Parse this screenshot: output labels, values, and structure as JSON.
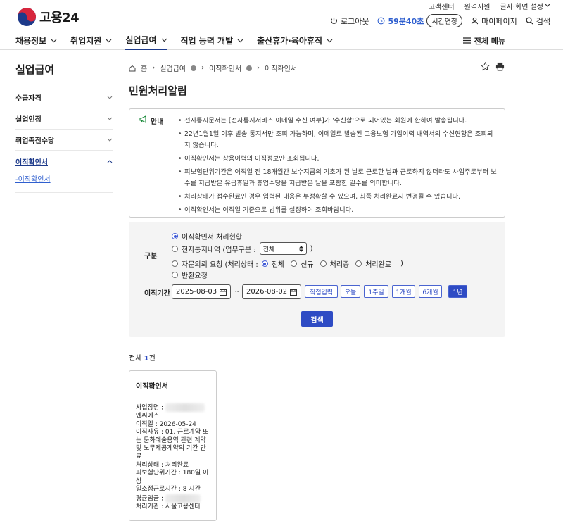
{
  "util": {
    "links": [
      "고객센터",
      "원격지원",
      "글자·화면 설정"
    ]
  },
  "logo": {
    "text": "고용24"
  },
  "header": {
    "logout": "로그아웃",
    "timer": "59분40초",
    "extend": "시간연장",
    "mypage": "마이페이지",
    "search": "검색"
  },
  "gnb": {
    "items": [
      "채용정보",
      "취업지원",
      "실업급여",
      "직업 능력 개발",
      "출산휴가·육아휴직"
    ],
    "all_menu": "전체 메뉴"
  },
  "side": {
    "title": "실업급여",
    "items": [
      "수급자격",
      "실업인정",
      "취업촉진수당",
      "이직확인서"
    ],
    "sub": "-이직확인서"
  },
  "breadcrumb": {
    "home": "홈",
    "l1": "실업급여",
    "l2": "이직확인서",
    "l3": "이직확인서"
  },
  "page": {
    "title": "민원처리알림"
  },
  "notice": {
    "label": "안내",
    "items": [
      "전자통지문서는 [전자통지서비스 이메일 수신 여부]가 '수신함'으로 되어있는 회원에 한하여 발송됩니다.",
      "22년1월1일 이후 발송 통지서만 조회 가능하며, 이메일로 발송된 고용보험 가입이력 내역서의 수신현황은 조회되지 않습니다.",
      "이직확인서는 상용이력의 이직정보만 조회됩니다.",
      "피보험단위기간은 이직일 전 18개월간 보수지급의 기초가 된 날로 근로한 날과 근로하지 않더라도 사업주로부터 보수를 지급받은 유급휴일과 휴업수당을 지급받은 날을 포함한 일수를 의미합니다.",
      "처리상태가 접수완료인 경우 입력된 내용은 부정확할 수 있으며, 최종 처리완료시 변경될 수 있습니다.",
      "이직확인서는 이직일 기준으로 범위를 설정하여 조회바랍니다."
    ]
  },
  "search": {
    "type_label": "구분",
    "opt1": "이직확인서 처리현황",
    "opt2": "전자통지내역 (업무구분 :",
    "opt2_select": "전체",
    "opt2_close": ")",
    "opt3": "자문의뢰 요청 (처리상태 :",
    "opt3_sub": [
      "전체",
      "신규",
      "처리중",
      "처리완료"
    ],
    "opt3_close": ")",
    "opt4": "반환요청",
    "period_label": "이직기간",
    "from": "2025-08-03",
    "tilde": "~",
    "to": "2026-08-02",
    "periods": [
      "직접입력",
      "오늘",
      "1주일",
      "1개월",
      "6개월",
      "1년"
    ],
    "button": "검색"
  },
  "result": {
    "prefix": "전체",
    "count": "1",
    "suffix": "건"
  },
  "card": {
    "title": "이직확인서",
    "workplace_label": "사업장명 :",
    "workplace_name": "엔씨에스",
    "leave_date": "이직일 : 2026-05-24",
    "reason": "이직사유 : 01. 근로계약 또는 문화예술용역 관련 계약 및 노무제공계약의 기간 만료",
    "status": "처리상태 : 처리완료",
    "insured_period": "피보험단위기간 : 180일 이상",
    "daily_hours": "일소정근로시간 : 8 시간",
    "avg_wage_label": "평균임금 :",
    "office": "처리기관 : 서울고용센터"
  },
  "colors": {
    "primary": "#2e4bc4",
    "navy": "#1d3a8a",
    "panel": "#f4f4f4"
  }
}
